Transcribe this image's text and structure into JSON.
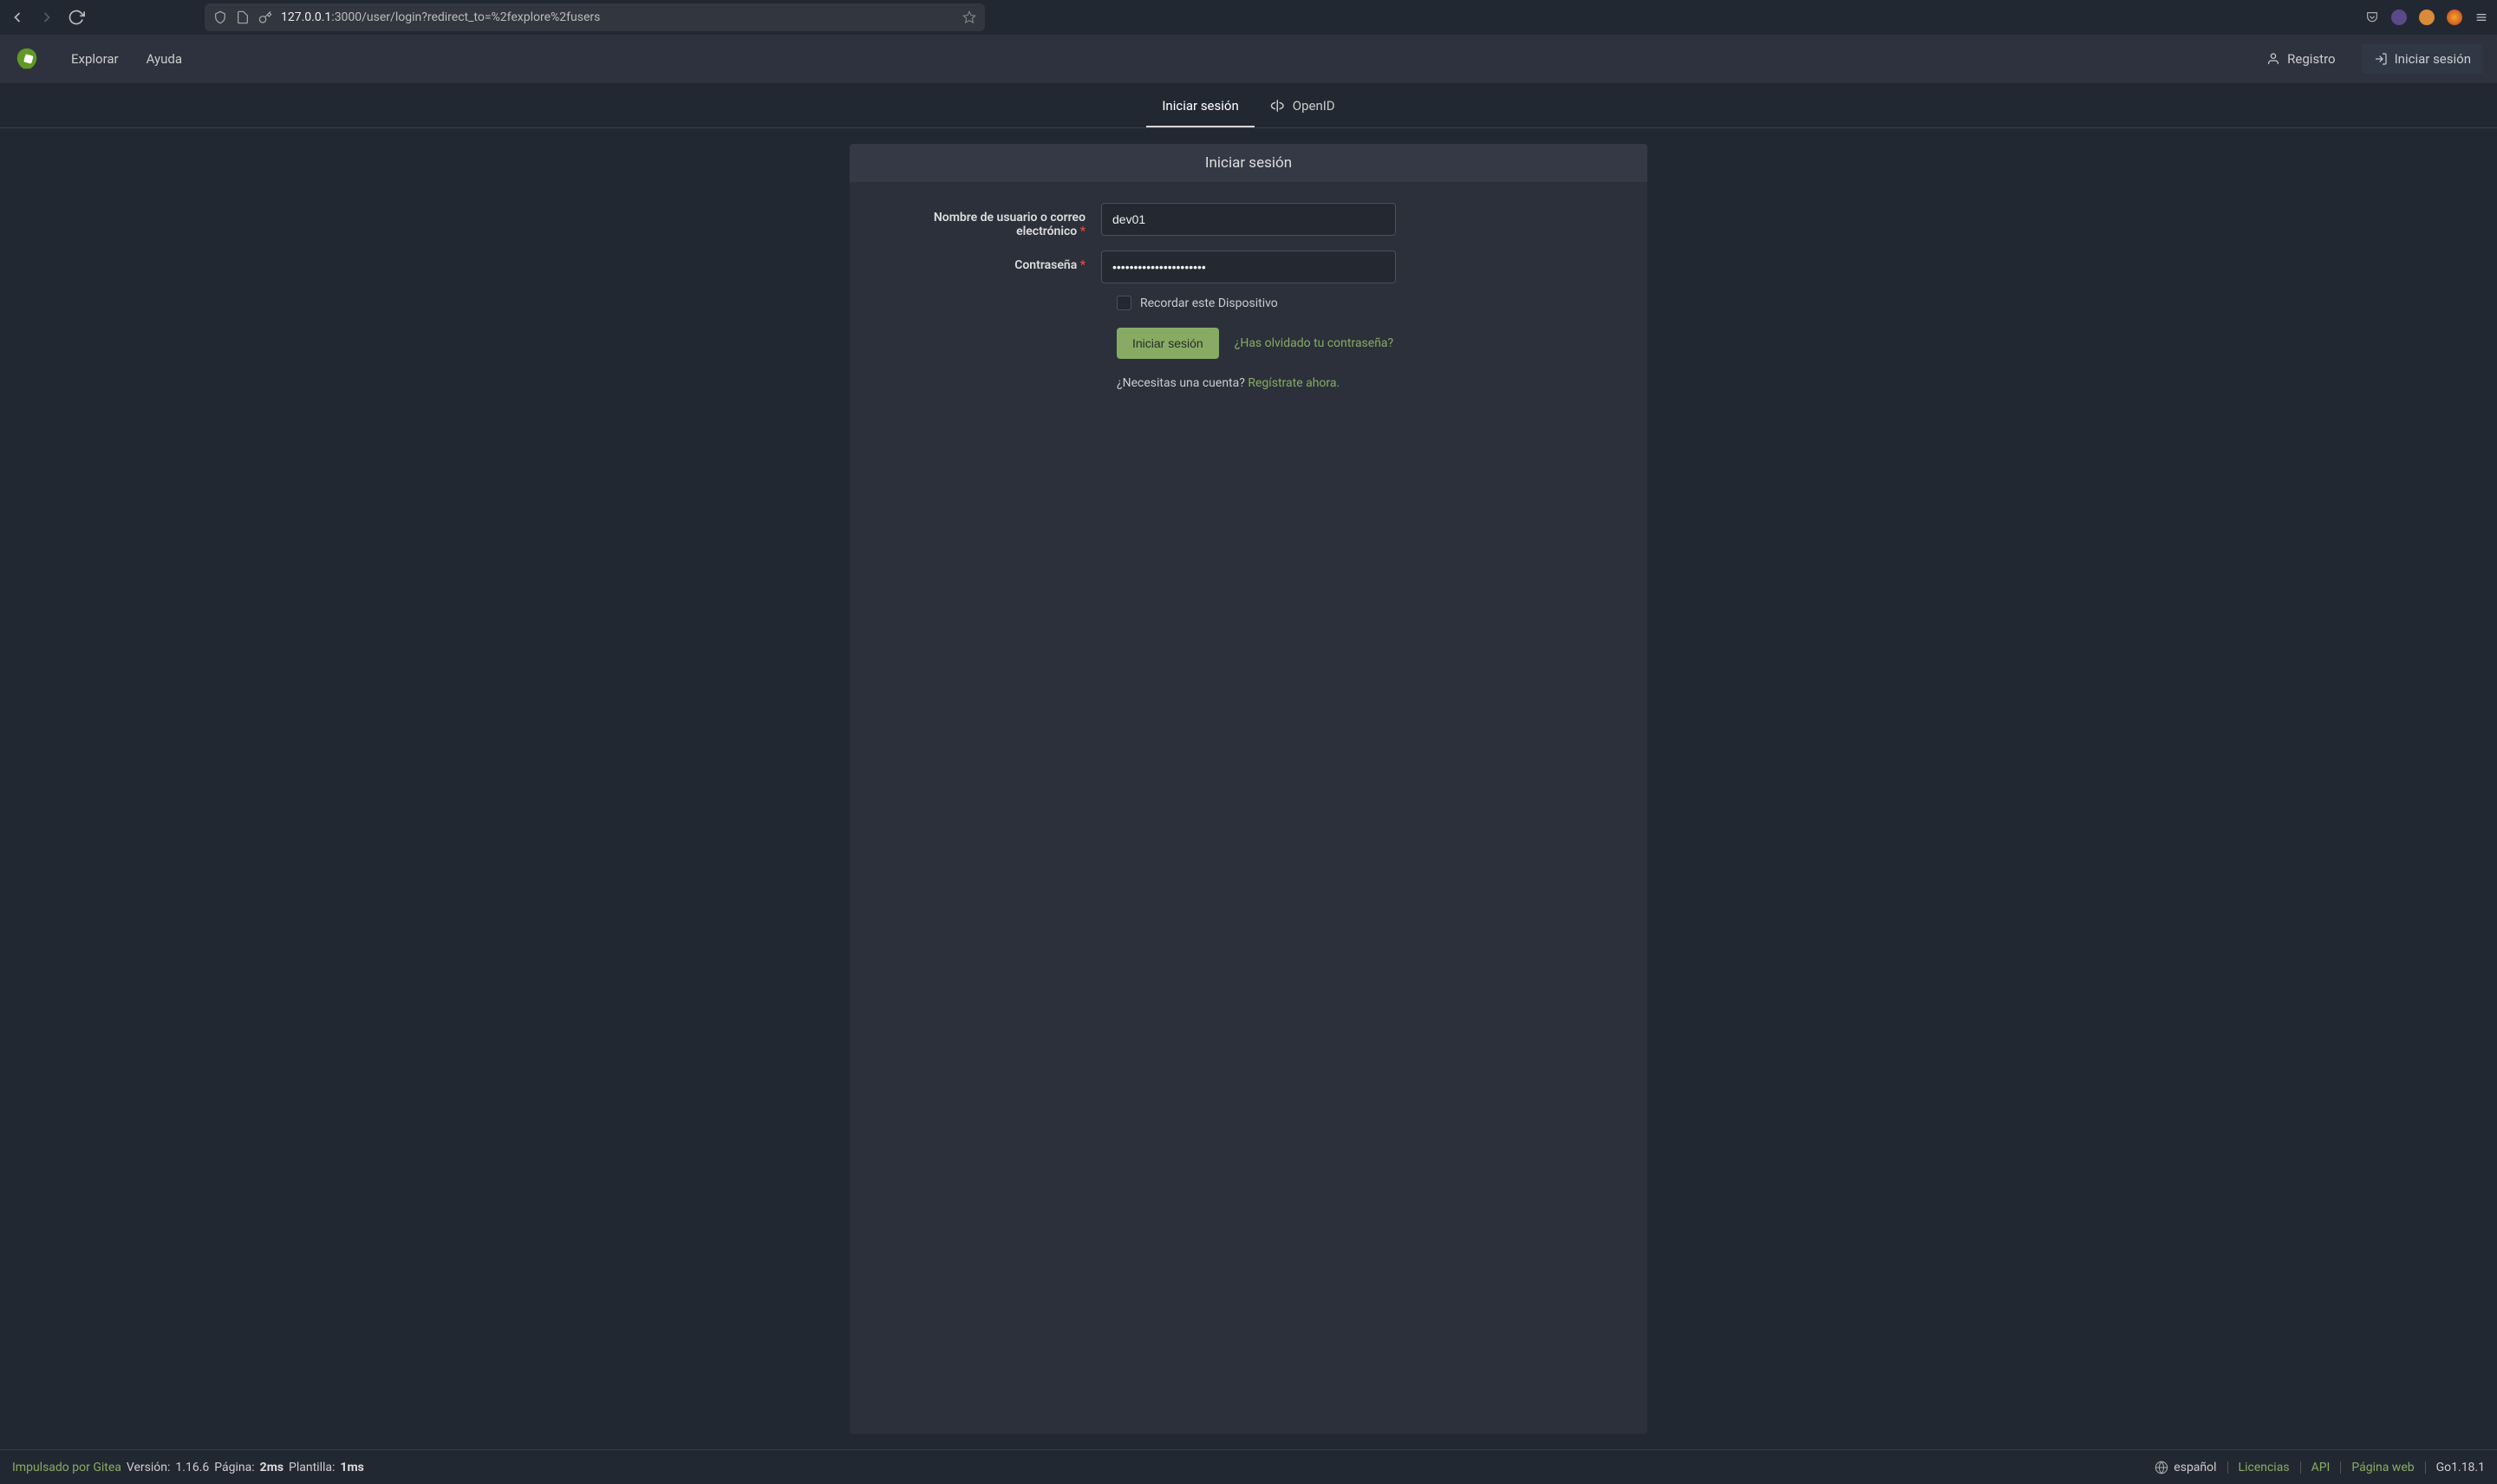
{
  "browser": {
    "url_host": "127.0.0.1",
    "url_path": ":3000/user/login?redirect_to=%2fexplore%2fusers"
  },
  "header": {
    "nav": {
      "explorar": "Explorar",
      "ayuda": "Ayuda"
    },
    "registro": "Registro",
    "iniciar_sesion": "Iniciar sesión"
  },
  "tabs": {
    "login": "Iniciar sesión",
    "openid": "OpenID"
  },
  "form": {
    "panel_title": "Iniciar sesión",
    "username_label": "Nombre de usuario o correo electrónico",
    "username_value": "dev01",
    "password_label": "Contraseña",
    "password_value": "••••••••••••••••••••••",
    "remember_label": "Recordar este Dispositivo",
    "submit_label": "Iniciar sesión",
    "forgot_label": "¿Has olvidado tu contraseña?",
    "need_account_prefix": "¿Necesitas una cuenta?",
    "register_now": "Regístrate ahora."
  },
  "footer": {
    "impulsado": "Impulsado por Gitea",
    "version_label": "Versión:",
    "version_value": "1.16.6",
    "pagina_label": "Página:",
    "pagina_value": "2ms",
    "plantilla_label": "Plantilla:",
    "plantilla_value": "1ms",
    "language": "español",
    "licencias": "Licencias",
    "api": "API",
    "pagina_web": "Página web",
    "go_version": "Go1.18.1"
  }
}
